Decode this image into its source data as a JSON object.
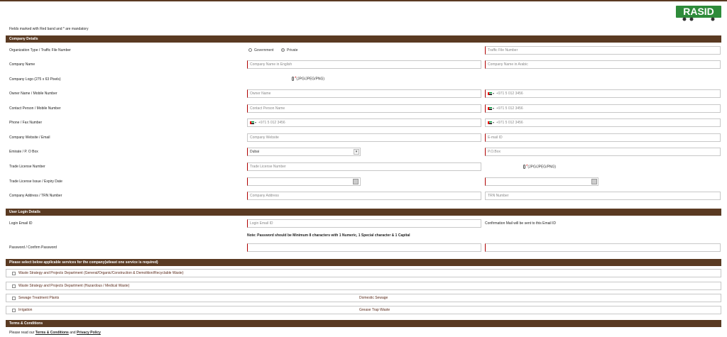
{
  "mandatory_note": "Fields marked with Red band and * are mandatory",
  "sections": {
    "company": "Company Details",
    "login": "User Login Details",
    "services": "Please select below applicable services for the company(atleast one service is required)",
    "terms": "Terms & Conditions"
  },
  "labels": {
    "org_type": "Organization Type / Traffic File Number",
    "company_name": "Company Name",
    "company_logo": "Company Logo (275 x 63 Pixels)",
    "owner": "Owner Name / Mobile Number",
    "contact": "Contact Person / Mobile Number",
    "phone_fax": "Phone / Fax Number",
    "website_email": "Company Website / Email",
    "emirate_po": "Emirate / P. O Box",
    "trade_license": "Trade License Number",
    "license_dates": "Trade License Issue / Expiry Date",
    "address_trn": "Company Address / TRN Number",
    "login_email": "Login Email ID",
    "password": "Password / Confirm Password"
  },
  "radios": {
    "government": "Government",
    "private": "Private",
    "selected": "Private"
  },
  "placeholders": {
    "traffic_file": "Traffic File Number",
    "name_en": "Company Name in English",
    "name_ar": "Company Name in Arabic",
    "owner_name": "Owner Name",
    "contact_name": "Contact Person Name",
    "website": "Company Website",
    "email": "E-mail ID",
    "po_box": "P.O.Box",
    "trade_license": "Trade License Number",
    "address": "Company Address",
    "trn": "TRN Number",
    "login_email": "Login Email ID"
  },
  "phone_placeholder": "+971 5 012 3456",
  "emirate_value": "Dubai",
  "file_hint": "(JPG/JPEG/PNG)",
  "confirm_mail_note": "Confirmation Mail will be sent to this Email ID",
  "password_note": "Note: Password should be Minimum 8 characters with 1 Numeric, 1 Special character & 1 Capital",
  "services": [
    {
      "left": "Waste Strategy and Projects Department (General/Organic/Construction & Demolition/Recyclable Waste)",
      "right": ""
    },
    {
      "left": "Waste Strategy and Projects Department (Hazardous / Medical Waste)",
      "right": ""
    },
    {
      "left": "Sewage Treatment Plants",
      "right": "Domestic Sewage"
    },
    {
      "left": "Irrigation",
      "right": "Grease Trap Waste"
    }
  ],
  "terms": {
    "prefix": "Please read our ",
    "link1": "Terms & Conditions",
    "mid": " and ",
    "link2": "Privacy Policy"
  },
  "logo_text": "RASID",
  "colors": {
    "section_bg": "#5a3a22",
    "required_band": "#b00000",
    "logo_green": "#2e8b3a"
  }
}
